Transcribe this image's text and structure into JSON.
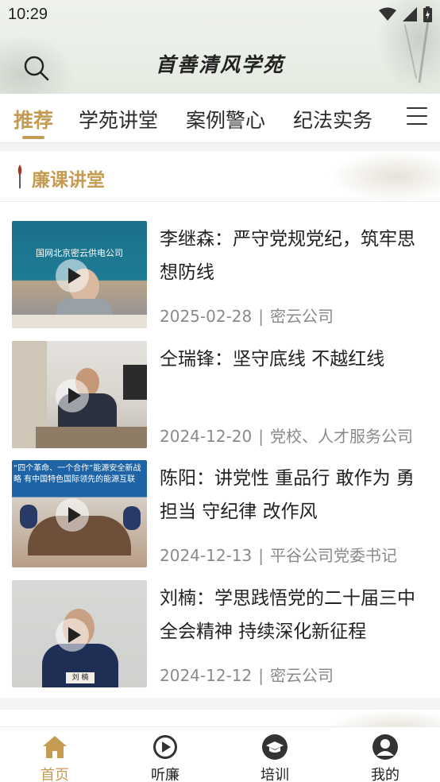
{
  "status_bar": {
    "time": "10:29"
  },
  "header": {
    "title": "首善清风学苑",
    "search_icon": "search-icon"
  },
  "tabs": [
    {
      "label": "推荐",
      "active": true
    },
    {
      "label": "学苑讲堂",
      "active": false
    },
    {
      "label": "案例警心",
      "active": false
    },
    {
      "label": "纪法实务",
      "active": false
    }
  ],
  "section": {
    "title": "廉课讲堂"
  },
  "articles": [
    {
      "title": "李继森：严守党规党纪，筑牢思想防线",
      "date": "2025-02-28",
      "source": "密云公司",
      "thumb_text": "国网北京密云供电公司"
    },
    {
      "title": "仝瑞锋：坚守底线 不越红线",
      "date": "2024-12-20",
      "source": "党校、人才服务公司",
      "thumb_text": ""
    },
    {
      "title": "陈阳：讲党性 重品行 敢作为 勇担当 守纪律 改作风",
      "date": "2024-12-13",
      "source": "平谷公司党委书记",
      "thumb_text": "“四个革命、一个合作”能源安全新战略 有中国特色国际领先的能源互联"
    },
    {
      "title": "刘楠：学思践悟党的二十届三中全会精神 持续深化新征程",
      "date": "2024-12-12",
      "source": "密云公司",
      "thumb_text": "刘 楠"
    }
  ],
  "bottom_nav": [
    {
      "label": "首页",
      "icon": "home-icon",
      "active": true
    },
    {
      "label": "听廉",
      "icon": "play-circle-icon",
      "active": false
    },
    {
      "label": "培训",
      "icon": "graduation-cap-icon",
      "active": false
    },
    {
      "label": "我的",
      "icon": "user-icon",
      "active": false
    }
  ],
  "colors": {
    "accent": "#c59b52",
    "text": "#222222",
    "meta": "#8a8a8a"
  }
}
